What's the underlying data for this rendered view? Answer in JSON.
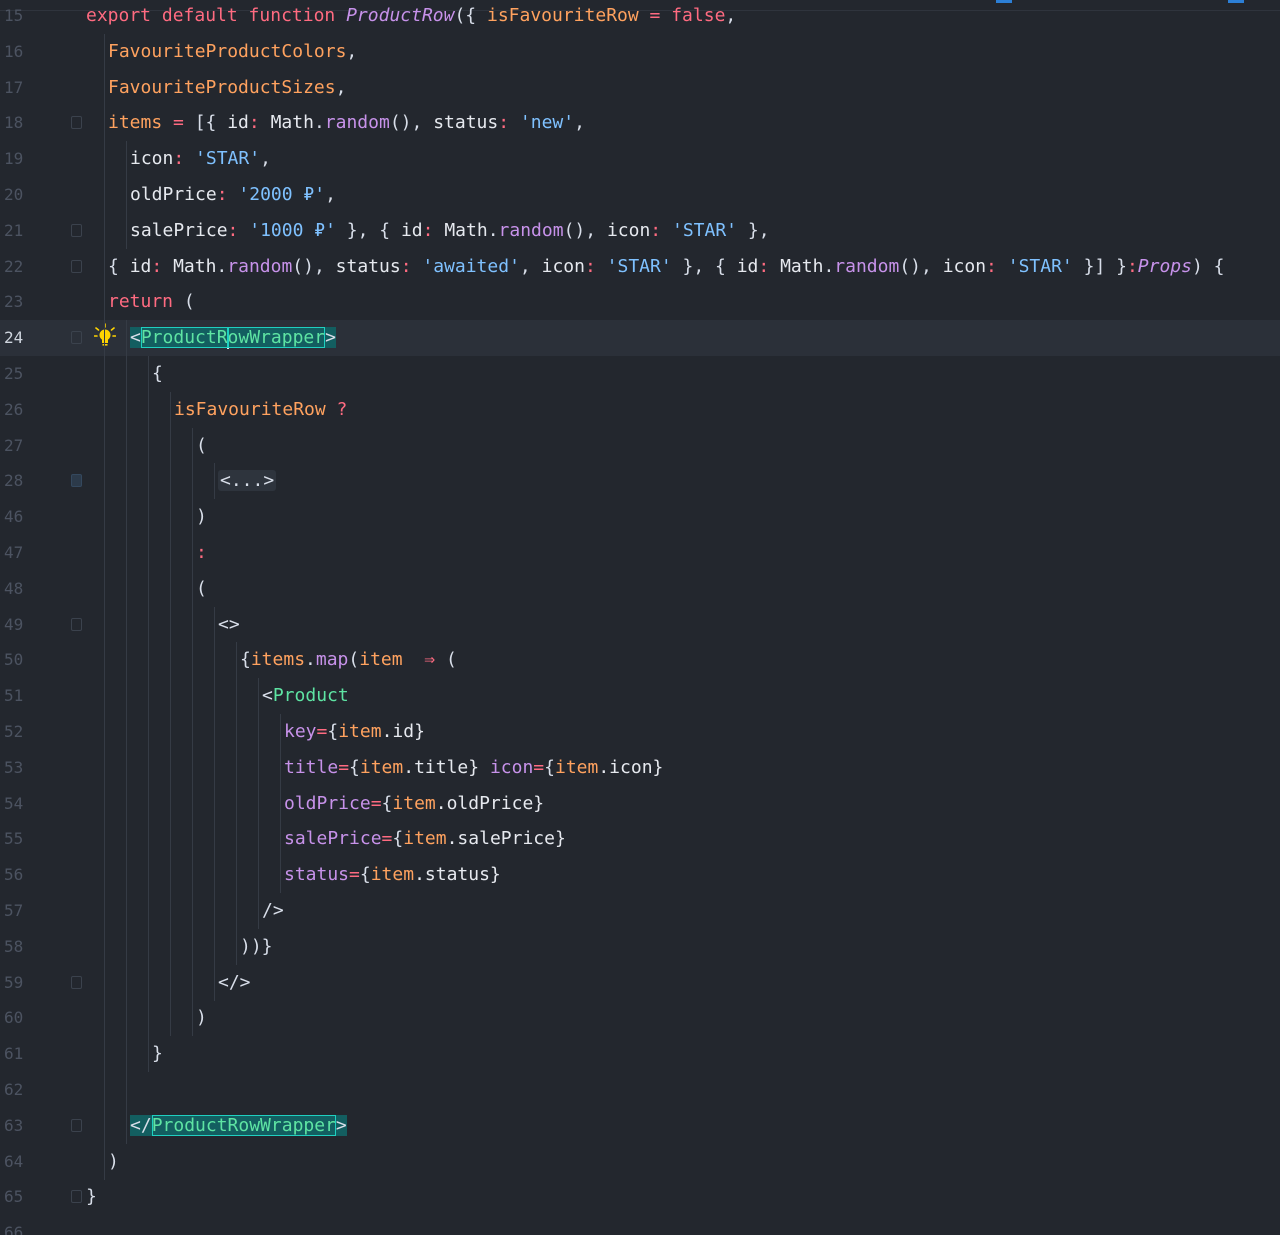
{
  "editor": {
    "current_line": 24,
    "lines": [
      {
        "num": "15",
        "indent": 0,
        "fold": false,
        "tokens": [
          {
            "t": "export default function ",
            "c": "kw"
          },
          {
            "t": "ProductRow",
            "c": "fn"
          },
          {
            "t": "({ ",
            "c": "punc"
          },
          {
            "t": "isFavouriteRow",
            "c": "param"
          },
          {
            "t": " = ",
            "c": "op"
          },
          {
            "t": "false",
            "c": "kw"
          },
          {
            "t": ",",
            "c": "punc"
          }
        ]
      },
      {
        "num": "16",
        "indent": 1,
        "fold": false,
        "tokens": [
          {
            "t": "FavouriteProductColors",
            "c": "param"
          },
          {
            "t": ",",
            "c": "punc"
          }
        ]
      },
      {
        "num": "17",
        "indent": 1,
        "fold": false,
        "tokens": [
          {
            "t": "FavouriteProductSizes",
            "c": "param"
          },
          {
            "t": ",",
            "c": "punc"
          }
        ]
      },
      {
        "num": "18",
        "indent": 1,
        "fold": true,
        "tokens": [
          {
            "t": "items",
            "c": "param"
          },
          {
            "t": " = ",
            "c": "op"
          },
          {
            "t": "[{ ",
            "c": "punc"
          },
          {
            "t": "id",
            "c": "prop"
          },
          {
            "t": ": ",
            "c": "op"
          },
          {
            "t": "Math",
            "c": "prop"
          },
          {
            "t": ".",
            "c": "punc"
          },
          {
            "t": "random",
            "c": "method"
          },
          {
            "t": "(), ",
            "c": "punc"
          },
          {
            "t": "status",
            "c": "prop"
          },
          {
            "t": ": ",
            "c": "op"
          },
          {
            "t": "'new'",
            "c": "str"
          },
          {
            "t": ",",
            "c": "punc"
          }
        ]
      },
      {
        "num": "19",
        "indent": 2,
        "fold": false,
        "tokens": [
          {
            "t": "icon",
            "c": "prop"
          },
          {
            "t": ": ",
            "c": "op"
          },
          {
            "t": "'STAR'",
            "c": "str"
          },
          {
            "t": ",",
            "c": "punc"
          }
        ]
      },
      {
        "num": "20",
        "indent": 2,
        "fold": false,
        "tokens": [
          {
            "t": "oldPrice",
            "c": "prop"
          },
          {
            "t": ": ",
            "c": "op"
          },
          {
            "t": "'2000 ₽'",
            "c": "str"
          },
          {
            "t": ",",
            "c": "punc"
          }
        ]
      },
      {
        "num": "21",
        "indent": 2,
        "fold": true,
        "tokens": [
          {
            "t": "salePrice",
            "c": "prop"
          },
          {
            "t": ": ",
            "c": "op"
          },
          {
            "t": "'1000 ₽'",
            "c": "str"
          },
          {
            "t": " }, { ",
            "c": "punc"
          },
          {
            "t": "id",
            "c": "prop"
          },
          {
            "t": ": ",
            "c": "op"
          },
          {
            "t": "Math",
            "c": "prop"
          },
          {
            "t": ".",
            "c": "punc"
          },
          {
            "t": "random",
            "c": "method"
          },
          {
            "t": "(), ",
            "c": "punc"
          },
          {
            "t": "icon",
            "c": "prop"
          },
          {
            "t": ": ",
            "c": "op"
          },
          {
            "t": "'STAR'",
            "c": "str"
          },
          {
            "t": " },",
            "c": "punc"
          }
        ]
      },
      {
        "num": "22",
        "indent": 1,
        "fold": true,
        "tokens": [
          {
            "t": "{ ",
            "c": "punc"
          },
          {
            "t": "id",
            "c": "prop"
          },
          {
            "t": ": ",
            "c": "op"
          },
          {
            "t": "Math",
            "c": "prop"
          },
          {
            "t": ".",
            "c": "punc"
          },
          {
            "t": "random",
            "c": "method"
          },
          {
            "t": "(), ",
            "c": "punc"
          },
          {
            "t": "status",
            "c": "prop"
          },
          {
            "t": ": ",
            "c": "op"
          },
          {
            "t": "'awaited'",
            "c": "str"
          },
          {
            "t": ", ",
            "c": "punc"
          },
          {
            "t": "icon",
            "c": "prop"
          },
          {
            "t": ": ",
            "c": "op"
          },
          {
            "t": "'STAR'",
            "c": "str"
          },
          {
            "t": " }, { ",
            "c": "punc"
          },
          {
            "t": "id",
            "c": "prop"
          },
          {
            "t": ": ",
            "c": "op"
          },
          {
            "t": "Math",
            "c": "prop"
          },
          {
            "t": ".",
            "c": "punc"
          },
          {
            "t": "random",
            "c": "method"
          },
          {
            "t": "(), ",
            "c": "punc"
          },
          {
            "t": "icon",
            "c": "prop"
          },
          {
            "t": ": ",
            "c": "op"
          },
          {
            "t": "'STAR'",
            "c": "str"
          },
          {
            "t": " }] }",
            "c": "punc"
          },
          {
            "t": ":",
            "c": "op"
          },
          {
            "t": "Props",
            "c": "type"
          },
          {
            "t": ") {",
            "c": "punc"
          }
        ]
      },
      {
        "num": "23",
        "indent": 1,
        "fold": false,
        "tokens": [
          {
            "t": "return",
            "c": "kw"
          },
          {
            "t": " (",
            "c": "punc"
          }
        ]
      },
      {
        "num": "24",
        "indent": 2,
        "fold": true,
        "bulb": true,
        "tokens": [
          {
            "t": "<",
            "c": "punc",
            "hl": true
          },
          {
            "t": "ProductR",
            "c": "tagbox",
            "hl": true,
            "caret_after": true
          },
          {
            "t": "owWrapper",
            "c": "tagbox",
            "hl": true
          },
          {
            "t": ">",
            "c": "punc",
            "hl": true
          }
        ]
      },
      {
        "num": "25",
        "indent": 3,
        "fold": false,
        "tokens": [
          {
            "t": "{",
            "c": "punc"
          }
        ]
      },
      {
        "num": "26",
        "indent": 4,
        "fold": false,
        "tokens": [
          {
            "t": "isFavouriteRow",
            "c": "param"
          },
          {
            "t": " ?",
            "c": "op"
          }
        ]
      },
      {
        "num": "27",
        "indent": 5,
        "fold": false,
        "tokens": [
          {
            "t": "(",
            "c": "punc"
          }
        ]
      },
      {
        "num": "28",
        "indent": 6,
        "fold": true,
        "collapsed": true,
        "tokens": [
          {
            "t": "<...>",
            "c": "fold"
          }
        ]
      },
      {
        "num": "46",
        "indent": 5,
        "fold": false,
        "tokens": [
          {
            "t": ")",
            "c": "punc"
          }
        ]
      },
      {
        "num": "47",
        "indent": 5,
        "fold": false,
        "tokens": [
          {
            "t": ":",
            "c": "op"
          }
        ]
      },
      {
        "num": "48",
        "indent": 5,
        "fold": false,
        "tokens": [
          {
            "t": "(",
            "c": "punc"
          }
        ]
      },
      {
        "num": "49",
        "indent": 6,
        "fold": true,
        "tokens": [
          {
            "t": "<>",
            "c": "punc"
          }
        ]
      },
      {
        "num": "50",
        "indent": 7,
        "fold": false,
        "tokens": [
          {
            "t": "{",
            "c": "punc"
          },
          {
            "t": "items",
            "c": "param"
          },
          {
            "t": ".",
            "c": "punc"
          },
          {
            "t": "map",
            "c": "method"
          },
          {
            "t": "(",
            "c": "punc"
          },
          {
            "t": "item",
            "c": "param"
          },
          {
            "t": "  ⇒ ",
            "c": "op"
          },
          {
            "t": "(",
            "c": "punc"
          }
        ]
      },
      {
        "num": "51",
        "indent": 8,
        "fold": false,
        "tokens": [
          {
            "t": "<",
            "c": "punc"
          },
          {
            "t": "Product",
            "c": "tag"
          }
        ]
      },
      {
        "num": "52",
        "indent": 9,
        "fold": false,
        "tokens": [
          {
            "t": "key",
            "c": "attr"
          },
          {
            "t": "=",
            "c": "op"
          },
          {
            "t": "{",
            "c": "punc"
          },
          {
            "t": "item",
            "c": "param"
          },
          {
            "t": ".id}",
            "c": "prop"
          }
        ]
      },
      {
        "num": "53",
        "indent": 9,
        "fold": false,
        "tokens": [
          {
            "t": "title",
            "c": "attr"
          },
          {
            "t": "=",
            "c": "op"
          },
          {
            "t": "{",
            "c": "punc"
          },
          {
            "t": "item",
            "c": "param"
          },
          {
            "t": ".title} ",
            "c": "prop"
          },
          {
            "t": "icon",
            "c": "attr"
          },
          {
            "t": "=",
            "c": "op"
          },
          {
            "t": "{",
            "c": "punc"
          },
          {
            "t": "item",
            "c": "param"
          },
          {
            "t": ".icon}",
            "c": "prop"
          }
        ]
      },
      {
        "num": "54",
        "indent": 9,
        "fold": false,
        "tokens": [
          {
            "t": "oldPrice",
            "c": "attr"
          },
          {
            "t": "=",
            "c": "op"
          },
          {
            "t": "{",
            "c": "punc"
          },
          {
            "t": "item",
            "c": "param"
          },
          {
            "t": ".oldPrice}",
            "c": "prop"
          }
        ]
      },
      {
        "num": "55",
        "indent": 9,
        "fold": false,
        "tokens": [
          {
            "t": "salePrice",
            "c": "attr"
          },
          {
            "t": "=",
            "c": "op"
          },
          {
            "t": "{",
            "c": "punc"
          },
          {
            "t": "item",
            "c": "param"
          },
          {
            "t": ".salePrice}",
            "c": "prop"
          }
        ]
      },
      {
        "num": "56",
        "indent": 9,
        "fold": false,
        "tokens": [
          {
            "t": "status",
            "c": "attr"
          },
          {
            "t": "=",
            "c": "op"
          },
          {
            "t": "{",
            "c": "punc"
          },
          {
            "t": "item",
            "c": "param"
          },
          {
            "t": ".status}",
            "c": "prop"
          }
        ]
      },
      {
        "num": "57",
        "indent": 8,
        "fold": false,
        "tokens": [
          {
            "t": "/>",
            "c": "punc"
          }
        ]
      },
      {
        "num": "58",
        "indent": 7,
        "fold": false,
        "tokens": [
          {
            "t": "))}",
            "c": "punc"
          }
        ]
      },
      {
        "num": "59",
        "indent": 6,
        "fold": true,
        "tokens": [
          {
            "t": "</>",
            "c": "punc"
          }
        ]
      },
      {
        "num": "60",
        "indent": 5,
        "fold": false,
        "tokens": [
          {
            "t": ")",
            "c": "punc"
          }
        ]
      },
      {
        "num": "61",
        "indent": 3,
        "fold": false,
        "tokens": [
          {
            "t": "}",
            "c": "punc"
          }
        ]
      },
      {
        "num": "62",
        "indent": 2,
        "fold": false,
        "tokens": []
      },
      {
        "num": "63",
        "indent": 2,
        "fold": true,
        "tokens": [
          {
            "t": "</",
            "c": "punc",
            "hl": true
          },
          {
            "t": "ProductRowWrapper",
            "c": "tagbox",
            "hl": true
          },
          {
            "t": ">",
            "c": "punc",
            "hl": true
          }
        ]
      },
      {
        "num": "64",
        "indent": 1,
        "fold": false,
        "tokens": [
          {
            "t": ")",
            "c": "punc"
          }
        ]
      },
      {
        "num": "65",
        "indent": 0,
        "fold": true,
        "tokens": [
          {
            "t": "}",
            "c": "punc"
          }
        ]
      },
      {
        "num": "66",
        "indent": 0,
        "fold": false,
        "tokens": []
      }
    ]
  },
  "icons": {
    "lightbulb": "lightbulb-icon",
    "fold": "fold-marker-icon"
  },
  "colors": {
    "background": "#23272e",
    "current_line": "#2b3039",
    "keyword": "#ff6b81",
    "tag": "#5ee4a3",
    "string": "#7fc1ff",
    "param": "#ffa25f",
    "attr": "#c792ea",
    "tag_highlight": "#135e60",
    "bulb": "#ffd400"
  }
}
